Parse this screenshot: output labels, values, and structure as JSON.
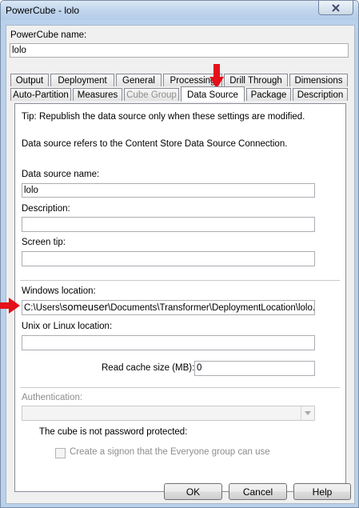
{
  "window": {
    "title": "PowerCube - lolo"
  },
  "cube": {
    "name_label": "PowerCube name:",
    "name_value": "lolo"
  },
  "tabs": {
    "row1": [
      "Output",
      "Deployment",
      "General",
      "Processing",
      "Drill Through",
      "Dimensions"
    ],
    "row2": [
      "Auto-Partition",
      "Measures",
      "Cube Group",
      "Data Source",
      "Package",
      "Description"
    ],
    "active": "Data Source",
    "disabled": [
      "Cube Group"
    ]
  },
  "datasource": {
    "tip": "Tip: Republish the data source only when these settings are modified.",
    "info": "Data source refers to the Content Store Data Source Connection.",
    "name_label": "Data source name:",
    "name_value": "lolo",
    "description_label": "Description:",
    "description_value": "",
    "screentip_label": "Screen tip:",
    "screentip_value": "",
    "windows_location_label": "Windows location:",
    "windows_location_value_prefix": "C:\\Users\\",
    "windows_location_value_user": "someuser",
    "windows_location_value_suffix": "\\Documents\\Transformer\\DeploymentLocation\\lolo.m",
    "unix_location_label": "Unix or Linux location:",
    "unix_location_value": "",
    "cache_label": "Read cache size (MB):",
    "cache_value": "0",
    "auth_label": "Authentication:",
    "password_status": "The cube is not password protected:",
    "signon_label": "Create a signon that the Everyone group can use"
  },
  "buttons": {
    "ok": "OK",
    "cancel": "Cancel",
    "help": "Help"
  },
  "colors": {
    "annotation_arrow": "#e4101a",
    "title_bar": "#c2d7ee"
  }
}
